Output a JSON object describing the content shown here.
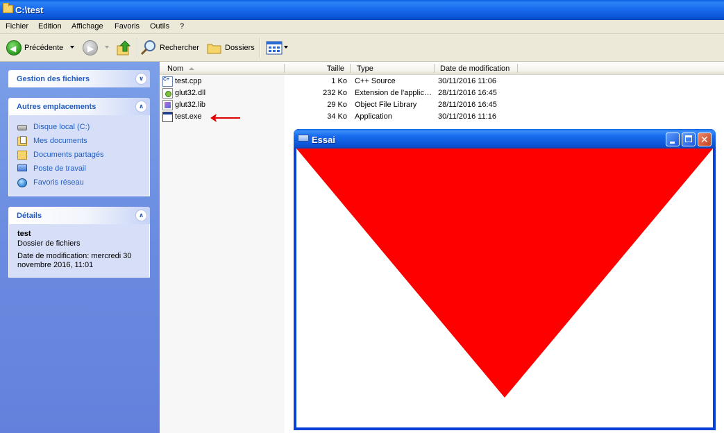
{
  "window": {
    "title": "C:\\test"
  },
  "menu": [
    "Fichier",
    "Edition",
    "Affichage",
    "Favoris",
    "Outils",
    "?"
  ],
  "toolbar": {
    "back_label": "Précédente",
    "search_label": "Rechercher",
    "folders_label": "Dossiers"
  },
  "tasks": {
    "file_tasks_title": "Gestion des fichiers",
    "other_places_title": "Autres emplacements",
    "other_places": [
      "Disque local (C:)",
      "Mes documents",
      "Documents partagés",
      "Poste de travail",
      "Favoris réseau"
    ],
    "details_title": "Détails",
    "details_name": "test",
    "details_type": "Dossier de fichiers",
    "details_date_line1": "Date de modification: mercredi 30",
    "details_date_line2": "novembre 2016, 11:01"
  },
  "columns": {
    "name": "Nom",
    "size": "Taille",
    "type": "Type",
    "modified": "Date de modification"
  },
  "files": [
    {
      "name": "test.cpp",
      "size": "1 Ko",
      "type": "C++ Source",
      "modified": "30/11/2016 11:06",
      "icon": "cpp-file-icon"
    },
    {
      "name": "glut32.dll",
      "size": "232 Ko",
      "type": "Extension de l'applic…",
      "modified": "28/11/2016 16:45",
      "icon": "dll-file-icon"
    },
    {
      "name": "glut32.lib",
      "size": "29 Ko",
      "type": "Object File Library",
      "modified": "28/11/2016 16:45",
      "icon": "lib-file-icon"
    },
    {
      "name": "test.exe",
      "size": "34 Ko",
      "type": "Application",
      "modified": "30/11/2016 11:16",
      "icon": "exe-file-icon"
    }
  ],
  "app_window": {
    "title": "Essai",
    "triangle_color": "#ff0000",
    "background_color": "#ffffff"
  },
  "colors": {
    "titlebar": "#0a56d8",
    "panel_blue": "#6a8be0",
    "link_blue": "#215dc6",
    "annotation_arrow": "#e00000"
  }
}
